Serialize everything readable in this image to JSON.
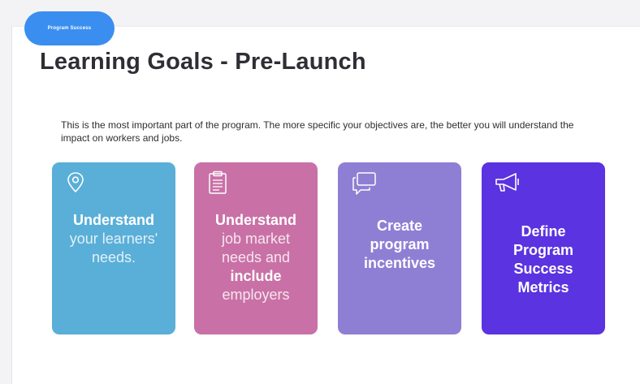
{
  "badge": {
    "label": "Program Success"
  },
  "title": "Learning Goals - Pre-Launch",
  "description": "This is the most important part of the program. The more specific your objectives are, the better you will understand the impact on workers and jobs.",
  "cards": [
    {
      "icon": "location-pin-icon",
      "color": "#5aafd8",
      "bold1": "Understand",
      "light1": "your learners'",
      "light2": "needs."
    },
    {
      "icon": "clipboard-icon",
      "color": "#c971a6",
      "bold1": "Understand",
      "light1": "job market",
      "light2": "needs and",
      "bold2": "include",
      "light3": "employers"
    },
    {
      "icon": "speech-bubbles-icon",
      "color": "#8f7fd4",
      "bold1": "Create",
      "bold2": "program",
      "bold3": "incentives"
    },
    {
      "icon": "megaphone-icon",
      "color": "#5b33e0",
      "bold1": "Define",
      "bold2": "Program",
      "bold3": "Success",
      "bold4": "Metrics"
    }
  ]
}
